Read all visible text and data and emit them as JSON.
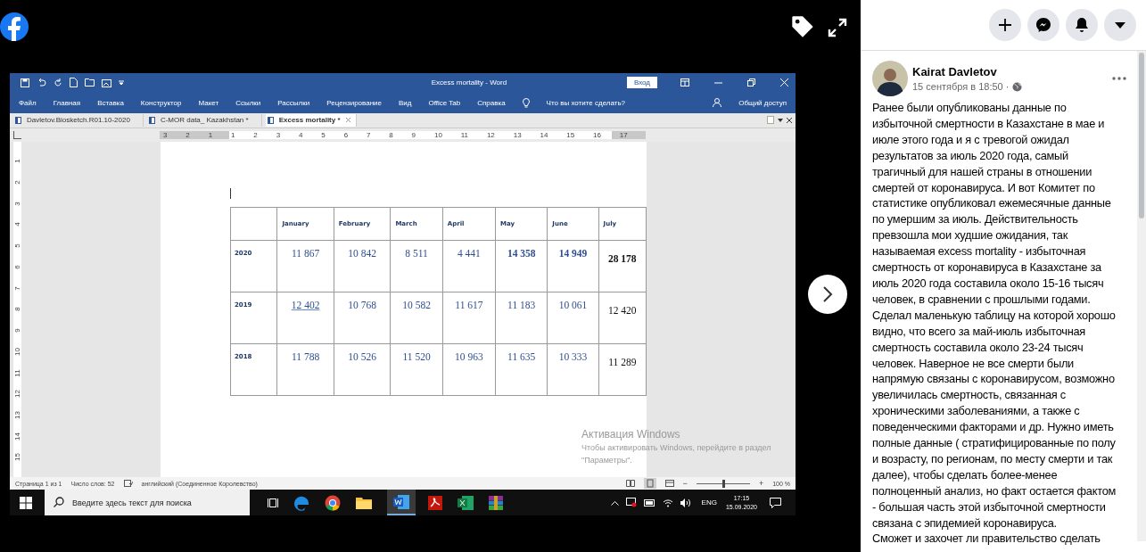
{
  "viewer": {
    "next_button": true
  },
  "word": {
    "title": "Excess mortality  -  Word",
    "signin": "Вход",
    "menu": [
      "Файл",
      "Главная",
      "Вставка",
      "Конструктор",
      "Макет",
      "Ссылки",
      "Рассылки",
      "Рецензирование",
      "Вид",
      "Office Tab",
      "Справка"
    ],
    "tell_me": "Что вы хотите сделать?",
    "share": "Общий доступ",
    "doc_tabs": [
      {
        "label": "Davletov.Biosketch.R01.10-2020",
        "selected": false
      },
      {
        "label": "C-MOR data_ Kazakhstan *",
        "selected": false
      },
      {
        "label": "Excess mortality *",
        "selected": true
      }
    ],
    "ruler": [
      "3",
      "2",
      "1",
      "1",
      "2",
      "3",
      "4",
      "5",
      "6",
      "7",
      "8",
      "9",
      "10",
      "11",
      "12",
      "13",
      "14",
      "15",
      "16",
      "17"
    ],
    "vruler": [
      "1",
      "2",
      "3",
      "4",
      "5",
      "6",
      "7",
      "8",
      "9",
      "10",
      "11",
      "12",
      "13",
      "14",
      "15"
    ],
    "table": {
      "columns": [
        "January",
        "February",
        "March",
        "April",
        "May",
        "June",
        "July"
      ],
      "rows": [
        {
          "year": "2020",
          "cells": [
            {
              "text": "11 867",
              "bold": false,
              "underlined": false
            },
            {
              "text": "10 842",
              "bold": false,
              "underlined": false
            },
            {
              "text": "8 511",
              "bold": false,
              "underlined": false
            },
            {
              "text": "4 441",
              "bold": false,
              "underlined": false
            },
            {
              "text": "14 358",
              "bold": true,
              "underlined": false
            },
            {
              "text": "14 949",
              "bold": true,
              "underlined": false
            },
            {
              "text": "28 178",
              "bold": true,
              "underlined": false
            }
          ]
        },
        {
          "year": "2019",
          "cells": [
            {
              "text": "12  402",
              "bold": false,
              "underlined": true
            },
            {
              "text": "10 768",
              "bold": false,
              "underlined": false
            },
            {
              "text": "10 582",
              "bold": false,
              "underlined": false
            },
            {
              "text": "11 617",
              "bold": false,
              "underlined": false
            },
            {
              "text": "11 183",
              "bold": false,
              "underlined": false
            },
            {
              "text": "10 061",
              "bold": false,
              "underlined": false
            },
            {
              "text": "12 420",
              "bold": false,
              "underlined": false
            }
          ]
        },
        {
          "year": "2018",
          "cells": [
            {
              "text": "11 788",
              "bold": false,
              "underlined": false
            },
            {
              "text": "10 526",
              "bold": false,
              "underlined": false
            },
            {
              "text": "11 520",
              "bold": false,
              "underlined": false
            },
            {
              "text": "10 963",
              "bold": false,
              "underlined": false
            },
            {
              "text": "11 635",
              "bold": false,
              "underlined": false
            },
            {
              "text": "10 333",
              "bold": false,
              "underlined": false
            },
            {
              "text": "11 289",
              "bold": false,
              "underlined": false
            }
          ]
        }
      ]
    },
    "activation": {
      "title": "Активация Windows",
      "text": "Чтобы активировать Windows, перейдите в раздел \"Параметры\"."
    },
    "status": {
      "page": "Страница 1 из 1",
      "words": "Число слов: 52",
      "language": "английский (Соединенное Королевство)",
      "zoom": "100 %",
      "zoom_out": "−",
      "zoom_in": "+",
      "level": 0.5
    },
    "taskbar": {
      "search_placeholder": "Введите здесь текст для поиска",
      "lang": "ENG",
      "time": "17:15",
      "date": "15.09.2020"
    }
  },
  "post": {
    "author": "Kairat Davletov",
    "date": "15 сентября в 18:50 · ",
    "paragraphs": [
      "Ранее были опубликованы данные по избыточной смертности в Казахстане в мае и июле этого года и я с тревогой ожидал результатов за июль 2020 года, самый трагичный для нашей страны в отношении смертей от коронавируса. И вот Комитет по статистике опубликовал ежемесячные данные по умершим за июль. Действительность превзошла мои худшие ожидания, так называемая excess mortality - избыточная смертность от коронавируса в Казахстане за июль 2020 года составила около 15-16 тысяч человек, в сравнении с прошлыми годами. Сделал маленькую таблицу на которой хорошо видно, что всего за май-июль избыточная смертность составила около 23-24 тысяч человек. Наверное не все смерти были напрямую связаны с коронавирусом, возможно увеличилась смертность, связанная с хроническими заболеваниями, а также с поведенческими факторами и др. Нужно иметь полные данные ( стратифицированные по полу и возрасту, по регионам, по месту смерти и так далее), чтобы сделать более-менее полноценный анализ, но факт остается фактом - большая часть этой избыточной смертности связана с эпидемией коронавируса.",
      "Сможет и захочет ли правительство сделать"
    ]
  }
}
